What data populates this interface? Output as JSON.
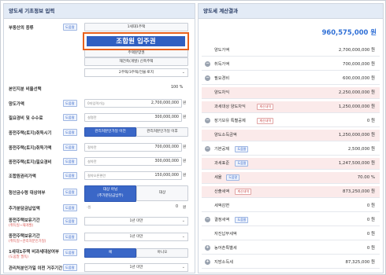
{
  "left_panel": {
    "title": "양도세 기초정보 입력",
    "property_type": {
      "label": "부동산의 종류",
      "badge": "도움말",
      "options": [
        "1세대1주택",
        "조합원 입주권",
        "주택분양권",
        "재건축(개발) 신축주택",
        "2주택/3주택/건물·토지"
      ]
    },
    "own_ratio": {
      "label": "본인지분 비율선택",
      "value": "100",
      "unit": "%"
    },
    "transfer_price": {
      "label": "양도가액",
      "badge": "도움말",
      "placeholder": "0자입력가능",
      "value": "2,700,000,000",
      "unit": "원"
    },
    "expense": {
      "label": "필요경비 및 수수료",
      "badge": "도움말",
      "placeholder": "설명란",
      "value": "300,000,000",
      "unit": "원"
    },
    "acquire_time": {
      "label": "종전주택(토지)취득시기",
      "badge": "도움말",
      "options": [
        "관리처분인가일 이전",
        "관리처분인가일 이후"
      ]
    },
    "prev_acquire_price": {
      "label": "종전주택(토지)취득가액",
      "badge": "도움말",
      "placeholder": "절약란",
      "value": "700,000,000",
      "unit": "원"
    },
    "prev_expense": {
      "label": "종전주택(토지)필요경비",
      "badge": "도움말",
      "placeholder": "설약란",
      "value": "300,000,000",
      "unit": "원"
    },
    "member_contribution": {
      "label": "조합원권리가액",
      "badge": "도움말",
      "placeholder": "절약오른편란",
      "value": "150,000,000",
      "unit": "원"
    },
    "settlement": {
      "label": "청산금수령 대상여부",
      "badge": "도움말",
      "options": [
        "대상 아님\n(추가분담금납부)",
        "대상"
      ]
    },
    "additional_payment": {
      "label": "추가분담금납입액",
      "badge": "도움말",
      "placeholder": "-원",
      "value": "0",
      "unit": "원"
    },
    "prev_holding": {
      "label": "종전주택보유기간",
      "sub": "(취득일~재개발)",
      "badge": "도움말",
      "value": "1년 미만"
    },
    "total_holding": {
      "label": "종전주택보유기간",
      "sub": "(취득일~관리처분인가일)",
      "badge": "도움말",
      "value": "1년 미만"
    },
    "one_household": {
      "label": "1세대1주택 비과세대상여부",
      "sub": "(도움말 필독)",
      "badge": "도움말",
      "options": [
        "예",
        "아니오"
      ]
    },
    "last_row": {
      "label": "관리처분인가일 이전 거주기간",
      "badge": "도움말",
      "value": "1년 미만"
    }
  },
  "right_panel": {
    "title": "양도세 계산결과",
    "total": "960,575,000 원",
    "rows": [
      {
        "sym": "",
        "name": "양도가액",
        "value": "2,700,000,000 원",
        "pink": false
      },
      {
        "sym": "−",
        "name": "취득가액",
        "value": "700,000,000 원",
        "pink": false
      },
      {
        "sym": "−",
        "name": "필요경비",
        "value": "600,000,000 원",
        "pink": false
      },
      {
        "sym": "",
        "name": "양도차익",
        "value": "2,250,000,000 원",
        "pink": true
      },
      {
        "sym": "",
        "name": "과세대상 양도차익",
        "tag": "계산내역",
        "value": "1,250,000,000 원",
        "pink": true
      },
      {
        "sym": "−",
        "name": "장기보유 특별공제",
        "tag": "계산내역",
        "value": "0 원",
        "pink": false
      },
      {
        "sym": "",
        "name": "양도소득금액",
        "value": "1,250,000,000 원",
        "pink": true
      },
      {
        "sym": "−",
        "name": "기본공제",
        "tagb": "도움말",
        "value": "2,500,000 원",
        "pink": false
      },
      {
        "sym": "",
        "name": "과세표준",
        "tagb": "도움말",
        "value": "1,247,500,000 원",
        "pink": true
      },
      {
        "sym": "",
        "name": "세율",
        "tagb": "도움말",
        "value": "70.00 %",
        "pink": true
      },
      {
        "sym": "",
        "name": "산출세액",
        "tag": "계산내역",
        "value": "873,250,000 원",
        "pink": true
      },
      {
        "sym": "",
        "name": "세액감면",
        "value": "0 원",
        "pink": false
      },
      {
        "sym": "−",
        "name": "결정세액",
        "tagb": "도움말",
        "value": "0 원",
        "pink": false
      },
      {
        "sym": "",
        "name": "자진납부세액",
        "value": "0 원",
        "pink": false
      },
      {
        "sym": "+",
        "name": "농어촌특별세",
        "value": "0 원",
        "pink": false
      },
      {
        "sym": "+",
        "name": "지방소득세",
        "value": "87,325,000 원",
        "pink": false
      }
    ]
  },
  "accent": "#2f5fc1",
  "highlight_color": "#e8601c"
}
